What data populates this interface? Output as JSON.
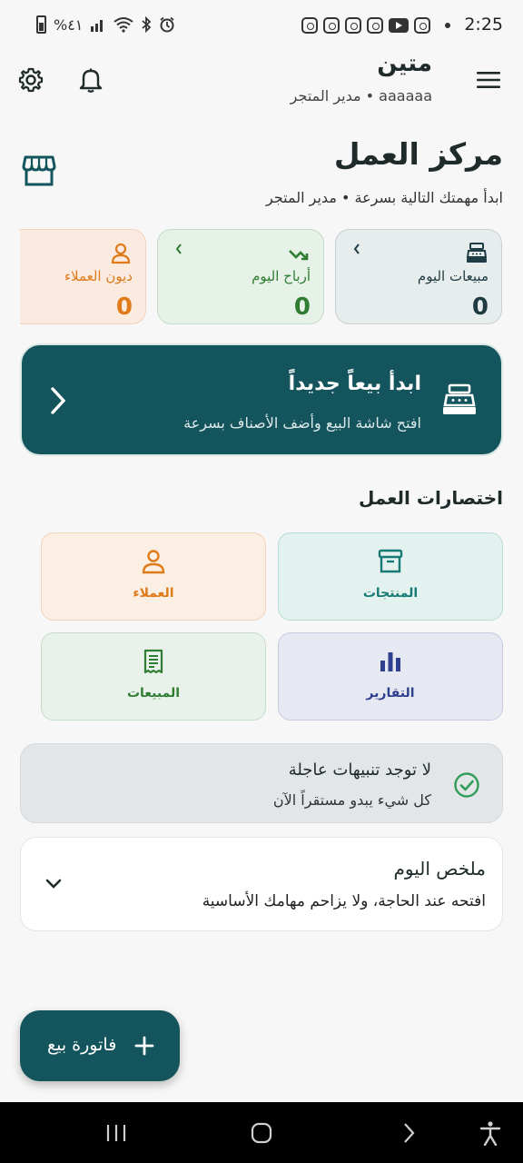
{
  "status_bar": {
    "time": "2:25",
    "battery_text": "%٤١",
    "icons": [
      "instagram-icon",
      "instagram-icon",
      "instagram-icon",
      "instagram-icon",
      "youtube-icon",
      "instagram-icon",
      "notification-dot-icon",
      "alarm-icon",
      "bluetooth-icon",
      "wifi-icon",
      "signal-icon",
      "battery-icon"
    ]
  },
  "app_bar": {
    "title": "متين",
    "subtitle": "aaaaaa • مدير المتجر",
    "icons": {
      "menu": "menu-icon",
      "settings": "gear-icon",
      "notifications": "bell-icon"
    }
  },
  "header": {
    "title": "مركز العمل",
    "subtitle": "ابدأ مهمتك التالية بسرعة • مدير المتجر",
    "icon": "store-icon"
  },
  "stats": [
    {
      "label": "مبيعات اليوم",
      "value": "0",
      "icon": "cash-register-icon",
      "color": "#1f3b44",
      "bg": "#e7ecec",
      "border": "#c7d1d3"
    },
    {
      "label": "أرباح اليوم",
      "value": "0",
      "icon": "trend-up-icon",
      "color": "#2e7d32",
      "bg": "#e6f1e7",
      "border": "#c4dcc6"
    },
    {
      "label": "ديون العملاء",
      "value": "0",
      "icon": "person-icon",
      "color": "#e07b1a",
      "bg": "#fbeadf",
      "border": "#f1d2bd"
    }
  ],
  "hero": {
    "title": "ابدأ بيعاً جديداً",
    "subtitle": "افتح شاشة البيع وأضف الأصناف بسرعة",
    "icon": "cash-register-icon",
    "chevron": "chevron-left-icon"
  },
  "shortcuts": {
    "title": "اختصارات العمل",
    "items": [
      {
        "label": "المنتجات",
        "icon": "archive-icon",
        "color": "#177a74",
        "bg": "#e3f1ef",
        "border": "#b9dcd7"
      },
      {
        "label": "العملاء",
        "icon": "person-icon",
        "color": "#e07b1a",
        "bg": "#fbeee3",
        "border": "#f1d4bc"
      },
      {
        "label": "التقارير",
        "icon": "bar-chart-icon",
        "color": "#2f3f8f",
        "bg": "#e6e9f1",
        "border": "#c6cbe0"
      },
      {
        "label": "المبيعات",
        "icon": "receipt-icon",
        "color": "#2e7d32",
        "bg": "#e9f2ea",
        "border": "#c8ddc9"
      }
    ]
  },
  "alert": {
    "title": "لا توجد تنبيهات عاجلة",
    "subtitle": "كل شيء يبدو مستقراً الآن",
    "icon": "check-circle-icon",
    "color": "#2e9d5a"
  },
  "summary": {
    "title": "ملخص اليوم",
    "subtitle": "افتحه عند الحاجة، ولا يزاحم مهامك الأساسية",
    "icon": "chevron-down-icon"
  },
  "fab": {
    "label": "فاتورة بيع",
    "icon": "plus-icon"
  },
  "nav_bar": {
    "icons": [
      "recents-icon",
      "home-icon",
      "back-icon",
      "accessibility-icon"
    ]
  },
  "colors": {
    "primary": "#14545c",
    "background": "#f6f7f6"
  }
}
